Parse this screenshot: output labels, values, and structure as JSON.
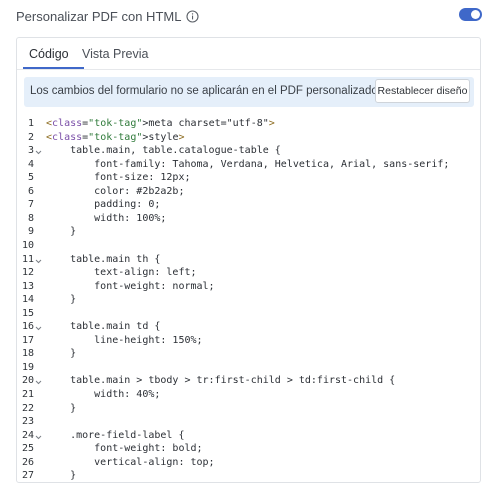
{
  "header": {
    "title": "Personalizar PDF con HTML",
    "toggle_on": true,
    "toggle_color": "#3f68c9"
  },
  "tabs": [
    {
      "label": "Código",
      "active": true
    },
    {
      "label": "Vista Previa",
      "active": false
    }
  ],
  "notice": {
    "text": "Los cambios del formulario no se aplicarán en el PDF personalizado",
    "button_label": "Restablecer diseño",
    "background": "#e5effa"
  },
  "editor": {
    "lines": [
      {
        "n": "1",
        "fold": false,
        "text": "<meta charset=\"utf-8\">"
      },
      {
        "n": "2",
        "fold": false,
        "text": "<style>"
      },
      {
        "n": "3",
        "fold": true,
        "text": "    table.main, table.catalogue-table {"
      },
      {
        "n": "4",
        "fold": false,
        "text": "        font-family: Tahoma, Verdana, Helvetica, Arial, sans-serif;"
      },
      {
        "n": "5",
        "fold": false,
        "text": "        font-size: 12px;"
      },
      {
        "n": "6",
        "fold": false,
        "text": "        color: #2b2a2b;"
      },
      {
        "n": "7",
        "fold": false,
        "text": "        padding: 0;"
      },
      {
        "n": "8",
        "fold": false,
        "text": "        width: 100%;"
      },
      {
        "n": "9",
        "fold": false,
        "text": "    }"
      },
      {
        "n": "10",
        "fold": false,
        "text": ""
      },
      {
        "n": "11",
        "fold": true,
        "text": "    table.main th {"
      },
      {
        "n": "12",
        "fold": false,
        "text": "        text-align: left;"
      },
      {
        "n": "13",
        "fold": false,
        "text": "        font-weight: normal;"
      },
      {
        "n": "14",
        "fold": false,
        "text": "    }"
      },
      {
        "n": "15",
        "fold": false,
        "text": ""
      },
      {
        "n": "16",
        "fold": true,
        "text": "    table.main td {"
      },
      {
        "n": "17",
        "fold": false,
        "text": "        line-height: 150%;"
      },
      {
        "n": "18",
        "fold": false,
        "text": "    }"
      },
      {
        "n": "19",
        "fold": false,
        "text": ""
      },
      {
        "n": "20",
        "fold": true,
        "text": "    table.main > tbody > tr:first-child > td:first-child {"
      },
      {
        "n": "21",
        "fold": false,
        "text": "        width: 40%;"
      },
      {
        "n": "22",
        "fold": false,
        "text": "    }"
      },
      {
        "n": "23",
        "fold": false,
        "text": ""
      },
      {
        "n": "24",
        "fold": true,
        "text": "    .more-field-label {"
      },
      {
        "n": "25",
        "fold": false,
        "text": "        font-weight: bold;"
      },
      {
        "n": "26",
        "fold": false,
        "text": "        vertical-align: top;"
      },
      {
        "n": "27",
        "fold": false,
        "text": "    }"
      }
    ]
  }
}
